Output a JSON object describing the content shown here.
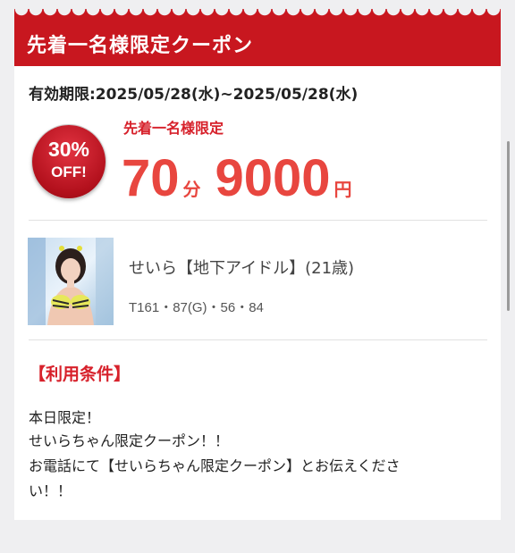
{
  "coupon": {
    "header_title": "先着一名様限定クーポン",
    "validity": "有効期限:2025/05/28(水)~2025/05/28(水)",
    "badge": {
      "percent": "30%",
      "off": "OFF!"
    },
    "first_label": "先着一名様限定",
    "duration_value": "70",
    "duration_unit": "分",
    "price_value": "9000",
    "price_unit": "円"
  },
  "cast": {
    "name": "せいら【地下アイドル】(21歳)",
    "spec": "T161・87(G)・56・84"
  },
  "conditions": {
    "title": "【利用条件】",
    "lines": [
      "本日限定！",
      "せいらちゃん限定クーポン！！",
      "お電話にて【せいらちゃん限定クーポン】とお伝えくださ",
      "い！！"
    ]
  },
  "colors": {
    "header_red": "#c8171f",
    "price_red": "#e8463f",
    "label_red": "#d7212b",
    "background": "#efeff1"
  }
}
